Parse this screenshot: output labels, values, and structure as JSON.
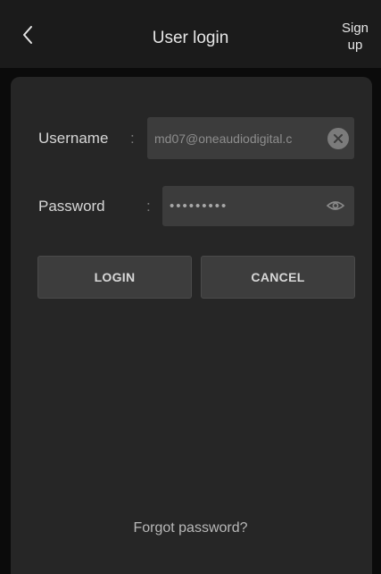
{
  "header": {
    "title": "User login",
    "signup_line1": "Sign",
    "signup_line2": "up"
  },
  "form": {
    "username_label": "Username",
    "username_value": "md07@oneaudiodigital.c",
    "password_label": "Password",
    "password_value": "•••••••••",
    "colon": ":"
  },
  "buttons": {
    "login": "LOGIN",
    "cancel": "CANCEL"
  },
  "footer": {
    "forgot": "Forgot password?"
  },
  "colors": {
    "header_bg": "#1b1b1b",
    "card_bg": "#262626",
    "input_bg": "#3c3c3c",
    "button_bg": "#3d3d3d"
  }
}
